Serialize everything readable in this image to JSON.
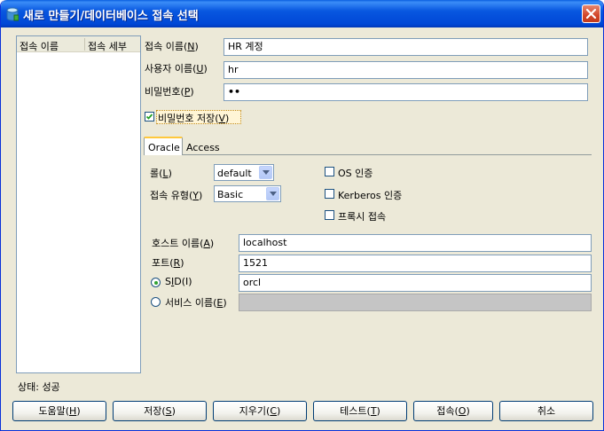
{
  "window": {
    "title": "새로 만들기/데이터베이스 접속 선택",
    "close_icon": "close-x-icon",
    "app_icon": "database-icon"
  },
  "connection_list": {
    "columns": [
      "접속 이름",
      "접속 세부"
    ]
  },
  "form": {
    "conn_name_label_pre": "접속 이름(",
    "conn_name_label_key": "N",
    "conn_name_label_post": ")",
    "conn_name_value": "HR 계정",
    "username_label_pre": "사용자 이름(",
    "username_label_key": "U",
    "username_label_post": ")",
    "username_value": "hr",
    "password_label_pre": "비밀번호(",
    "password_label_key": "P",
    "password_label_post": ")",
    "password_value": "••",
    "save_password_label_pre": "비밀번호 저장(",
    "save_password_label_key": "V",
    "save_password_label_post": ")",
    "save_password_checked": true
  },
  "tabs": [
    {
      "label": "Oracle",
      "active": true
    },
    {
      "label": "Access",
      "active": false
    }
  ],
  "oracle": {
    "role_label_pre": "롤(",
    "role_label_key": "L",
    "role_label_post": ")",
    "role_value": "default",
    "conn_type_label_pre": "접속 유형(",
    "conn_type_label_key": "Y",
    "conn_type_label_post": ")",
    "conn_type_value": "Basic",
    "os_auth_label": "OS 인증",
    "kerberos_label": "Kerberos 인증",
    "proxy_label": "프록시 접속",
    "host_label_pre": "호스트 이름(",
    "host_label_key": "A",
    "host_label_post": ")",
    "host_value": "localhost",
    "port_label_pre": "포트(",
    "port_label_key": "R",
    "port_label_post": ")",
    "port_value": "1521",
    "sid_label_pre": "S",
    "sid_label_key": "I",
    "sid_label_post": "D(I)",
    "sid_value": "orcl",
    "sid_selected": true,
    "service_label_pre": "서비스 이름(",
    "service_label_key": "E",
    "service_label_post": ")",
    "service_value": ""
  },
  "status": {
    "text": "상태: 성공"
  },
  "buttons": {
    "help_pre": "도움말(",
    "help_key": "H",
    "save_pre": "저장(",
    "save_key": "S",
    "clear_pre": "지우기(",
    "clear_key": "C",
    "test_pre": "테스트(",
    "test_key": "T",
    "connect_pre": "접속(",
    "connect_key": "O",
    "close_paren": ")",
    "cancel": "취소"
  },
  "colors": {
    "titlebar": "#0a5fe0",
    "dialog_bg": "#ece9d8",
    "field_border": "#7f9db9",
    "tab_highlight": "#ffc83c",
    "disabled_field": "#c5c5c5"
  }
}
